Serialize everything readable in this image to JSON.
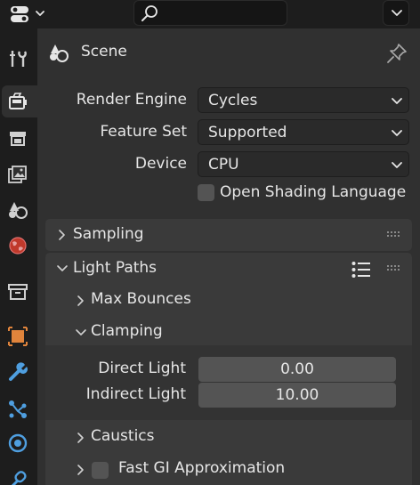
{
  "header": {
    "search_placeholder": ""
  },
  "sidebar": {
    "tabs": [
      {
        "name": "tool-tab-icon",
        "active": false
      },
      {
        "name": "render-tab-icon",
        "active": true
      },
      {
        "name": "output-tab-icon",
        "active": false
      },
      {
        "name": "view-layer-tab-icon",
        "active": false
      },
      {
        "name": "scene-tab-icon",
        "active": false
      },
      {
        "name": "world-tab-icon",
        "active": false
      },
      {
        "name": "collection-tab-icon",
        "active": false
      },
      {
        "name": "object-tab-icon",
        "active": false
      },
      {
        "name": "modifier-tab-icon",
        "active": false
      },
      {
        "name": "particles-tab-icon",
        "active": false
      },
      {
        "name": "physics-tab-icon",
        "active": false
      },
      {
        "name": "constraints-tab-icon",
        "active": false
      }
    ]
  },
  "context": {
    "title": "Scene"
  },
  "render": {
    "engine_label": "Render Engine",
    "engine_value": "Cycles",
    "feature_set_label": "Feature Set",
    "feature_set_value": "Supported",
    "device_label": "Device",
    "device_value": "CPU",
    "osl_label": "Open Shading Language",
    "osl_checked": false
  },
  "panels": {
    "sampling": {
      "title": "Sampling",
      "expanded": false
    },
    "light_paths": {
      "title": "Light Paths",
      "expanded": true,
      "max_bounces": {
        "title": "Max Bounces",
        "expanded": false
      },
      "clamping": {
        "title": "Clamping",
        "expanded": true,
        "direct_light_label": "Direct Light",
        "direct_light_value": "0.00",
        "indirect_light_label": "Indirect Light",
        "indirect_light_value": "10.00"
      },
      "caustics": {
        "title": "Caustics",
        "expanded": false
      },
      "fast_gi": {
        "title": "Fast GI Approximation",
        "expanded": false,
        "checked": false
      }
    }
  },
  "colors": {
    "background": "#303030",
    "header": "#1d1d1d",
    "panel": "#3a3a3a",
    "field": "#545454",
    "accent_orange": "#e0843c",
    "accent_blue": "#4f9fe0"
  }
}
